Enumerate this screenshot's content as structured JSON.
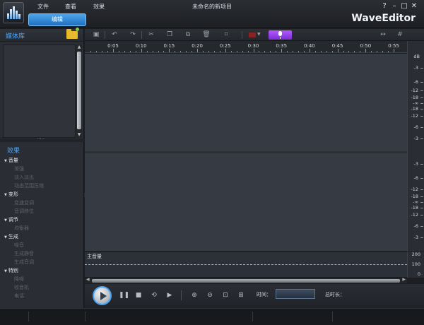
{
  "app": {
    "brand": "WaveEditor",
    "window_title": "未命名的新项目",
    "menu": [
      "文件",
      "查看",
      "效果"
    ],
    "active_tab": "编辑",
    "window_buttons": [
      "?",
      "–",
      "□",
      "✕"
    ]
  },
  "media_library": {
    "title": "媒体库"
  },
  "effects": {
    "title": "效果",
    "groups": [
      {
        "label": "音量",
        "items": [
          "渐强",
          "淡入淡出",
          "动态范围压缩"
        ]
      },
      {
        "label": "变形",
        "items": [
          "变速变调",
          "音调移位"
        ]
      },
      {
        "label": "调节",
        "items": [
          "均衡器"
        ]
      },
      {
        "label": "生成",
        "items": [
          "噪音",
          "生成静音",
          "生成音调"
        ]
      },
      {
        "label": "特别",
        "items": [
          "降噪",
          "收音机",
          "电话"
        ]
      }
    ]
  },
  "ruler": {
    "ticks": [
      "0:05",
      "0:10",
      "0:15",
      "0:20",
      "0:25",
      "0:30",
      "0:35",
      "0:40",
      "0:45",
      "0:50",
      "0:55"
    ]
  },
  "db_scale": {
    "unit": "dB",
    "channel1": [
      "-3",
      "-6",
      "-12",
      "-18",
      "-∞",
      "-18",
      "-12",
      "-6",
      "-3"
    ],
    "channel2": [
      "-3",
      "-6",
      "-12",
      "-18",
      "-∞",
      "-18",
      "-12",
      "-6",
      "-3"
    ]
  },
  "master": {
    "label": "主音量",
    "scale": [
      "200",
      "100",
      "0"
    ]
  },
  "transport": {
    "time_label": "时间：",
    "total_label": "总时长："
  },
  "colors": {
    "accent": "#4ba6ff",
    "record": "#9b45ee",
    "wave_bg": "#353a43"
  }
}
